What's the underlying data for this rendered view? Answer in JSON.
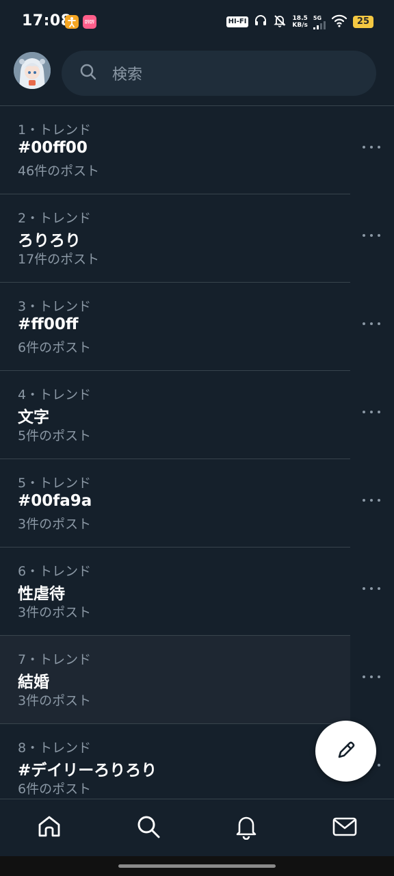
{
  "status_bar": {
    "time": "17:08",
    "hifi": "HI-FI",
    "speed_value": "18.5",
    "speed_unit": "KB/s",
    "network": "5G",
    "battery": "25",
    "icons": [
      "accessibility-app-icon",
      "notification-app-icon",
      "headphones-icon",
      "bell-muted-icon",
      "signal-icon",
      "wifi-icon",
      "battery-icon"
    ]
  },
  "header": {
    "search_placeholder": "検索"
  },
  "trends": [
    {
      "meta": "1・トレンド",
      "title": "#00ff00",
      "count": "46件のポスト"
    },
    {
      "meta": "2・トレンド",
      "title": "ろりろり",
      "count": "17件のポスト"
    },
    {
      "meta": "3・トレンド",
      "title": "#ff00ff",
      "count": "6件のポスト"
    },
    {
      "meta": "4・トレンド",
      "title": "文字",
      "count": "5件のポスト"
    },
    {
      "meta": "5・トレンド",
      "title": "#00fa9a",
      "count": "3件のポスト"
    },
    {
      "meta": "6・トレンド",
      "title": "性虐待",
      "count": "3件のポスト"
    },
    {
      "meta": "7・トレンド",
      "title": "結婚",
      "count": "3件のポスト"
    },
    {
      "meta": "8・トレンド",
      "title": "#デイリーろりろり",
      "count": "6件のポスト"
    }
  ],
  "bottom_nav": {
    "items": [
      "home-icon",
      "search-icon",
      "bell-icon",
      "mail-icon"
    ]
  },
  "colors": {
    "background": "#15202b",
    "secondary_text": "#8b98a5",
    "divider": "#38444d",
    "battery": "#f4c842"
  }
}
